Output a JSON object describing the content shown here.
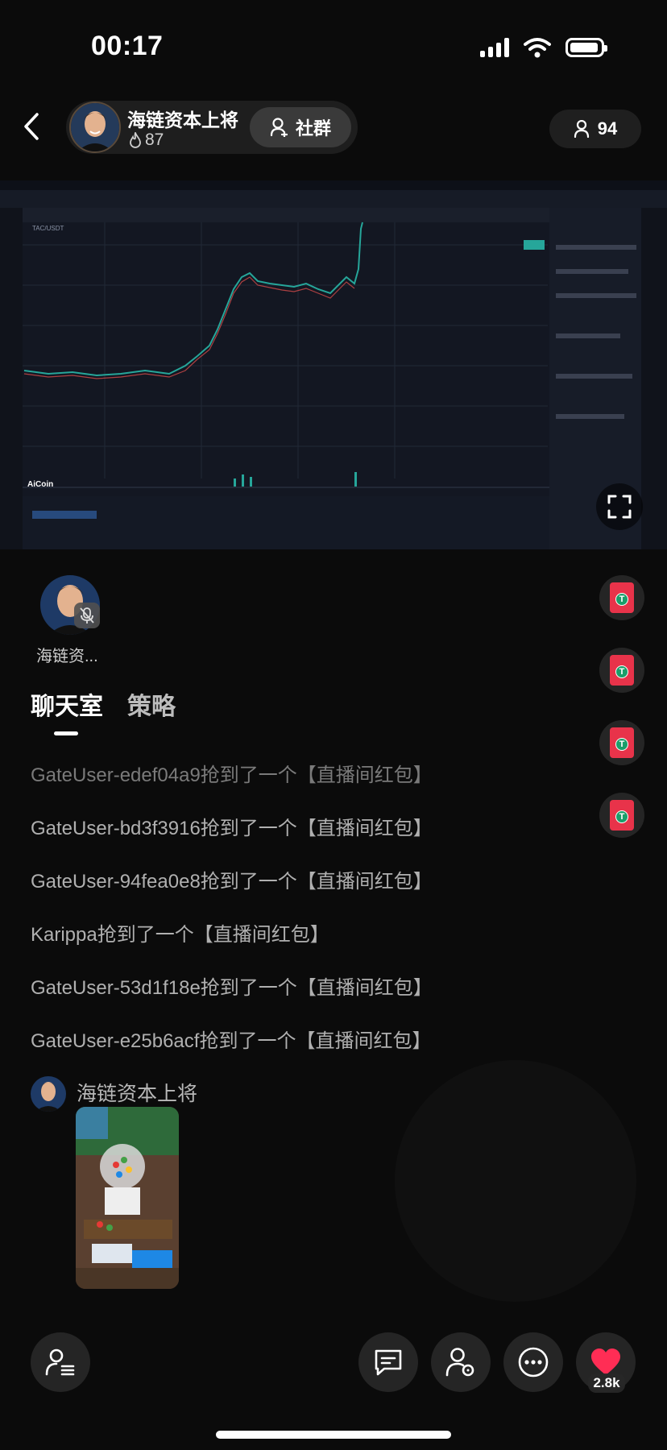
{
  "status_bar": {
    "time": "00:17"
  },
  "header": {
    "host_name": "海链资本上将",
    "host_heat": "87",
    "community_label": "社群",
    "viewer_count": "94"
  },
  "video": {
    "chart_title": "TAC/USDT",
    "brand": "AiCoin",
    "icons": [
      "expand-icon"
    ]
  },
  "speaker": {
    "name": "海链资..."
  },
  "tabs": [
    {
      "label": "聊天室"
    },
    {
      "label": "策略"
    }
  ],
  "messages": [
    "GateUser-edef04a9抢到了一个【直播间红包】",
    "GateUser-bd3f3916抢到了一个【直播间红包】",
    "GateUser-94fea0e8抢到了一个【直播间红包】",
    "Karippa抢到了一个【直播间红包】",
    "GateUser-53d1f18e抢到了一个【直播间红包】",
    "GateUser-e25b6acf抢到了一个【直播间红包】"
  ],
  "post": {
    "author": "海链资本上将"
  },
  "footer": {
    "like_count": "2.8k"
  },
  "colors": {
    "accent_red": "#ff2d55",
    "packet_red": "#e8334a",
    "chart_green": "#26a69a"
  }
}
